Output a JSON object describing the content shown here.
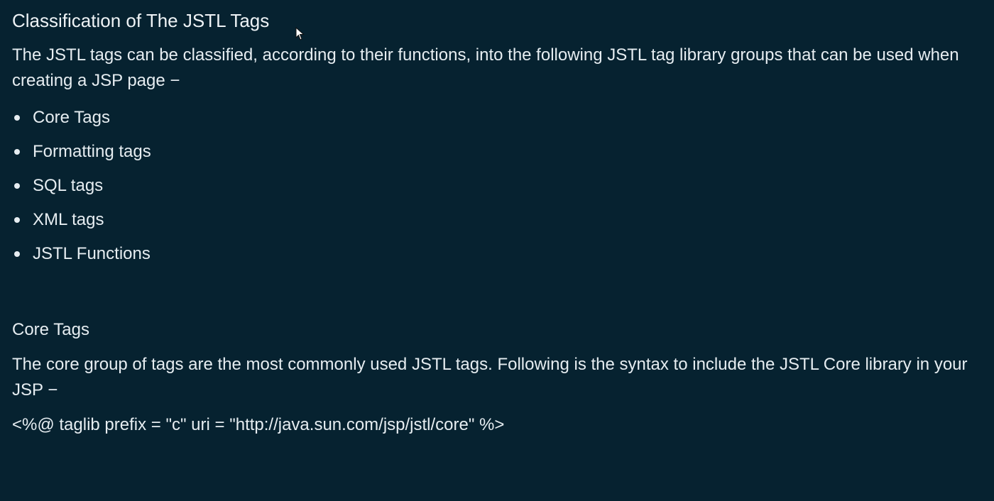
{
  "page": {
    "title": "Classification of The JSTL Tags",
    "intro": "The JSTL tags can be classified, according to their functions, into the following JSTL tag library groups that can be used when creating a JSP page −",
    "groups": [
      "Core Tags",
      "Formatting tags",
      "SQL tags",
      "XML tags",
      "JSTL Functions"
    ]
  },
  "core_section": {
    "heading": "Core Tags",
    "description": "The core group of tags are the most commonly used JSTL tags. Following is the syntax to include the JSTL Core library in your JSP −",
    "syntax": "<%@ taglib prefix = \"c\" uri = \"http://java.sun.com/jsp/jstl/core\" %>"
  },
  "colors": {
    "background": "#062230",
    "text": "#e6edf1"
  },
  "icons": {
    "pointer": "mouse-pointer-icon",
    "bullet": "bullet-dot-icon"
  }
}
